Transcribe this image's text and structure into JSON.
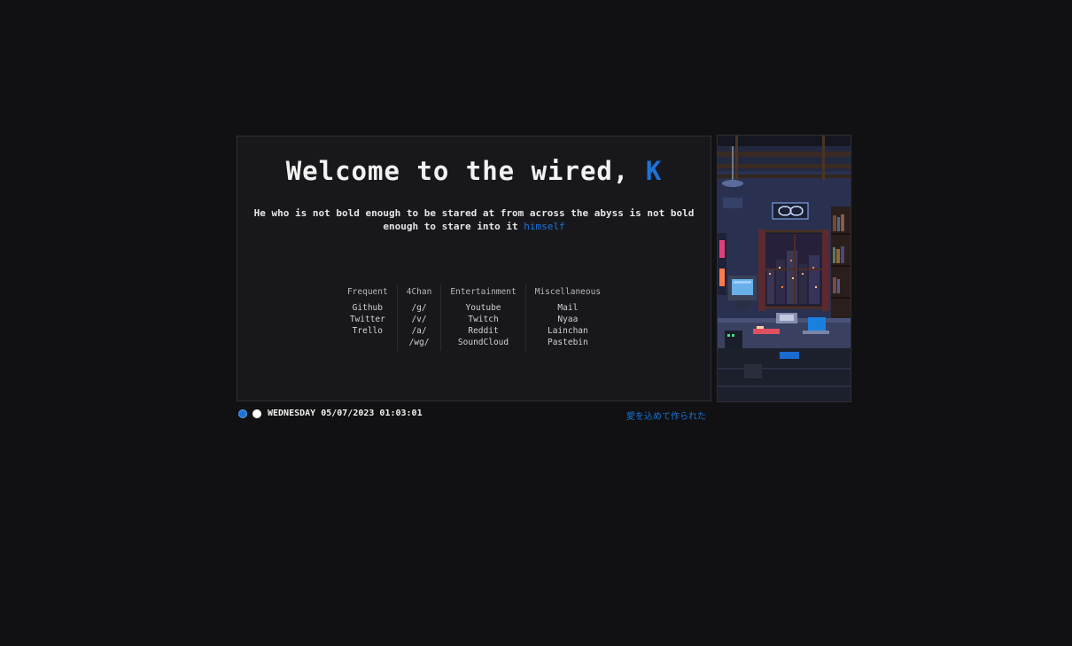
{
  "welcome": {
    "prefix": "Welcome to the wired, ",
    "name": "K"
  },
  "quote": {
    "text": "He who is not bold enough to be stared at from across the abyss is not bold enough to stare into it ",
    "accent": "himself"
  },
  "link_columns": [
    {
      "heading": "Frequent",
      "items": [
        "Github",
        "Twitter",
        "Trello"
      ]
    },
    {
      "heading": "4Chan",
      "items": [
        "/g/",
        "/v/",
        "/a/",
        "/wg/"
      ]
    },
    {
      "heading": "Entertainment",
      "items": [
        "Youtube",
        "Twitch",
        "Reddit",
        "SoundCloud"
      ]
    },
    {
      "heading": "Miscellaneous",
      "items": [
        "Mail",
        "Nyaa",
        "Lainchan",
        "Pastebin"
      ]
    }
  ],
  "status": {
    "datetime": "WEDNESDAY 05/07/2023 01:03:01",
    "credit": "愛を込めて作られた"
  },
  "colors": {
    "accent": "#1a74d8",
    "background": "#111113",
    "panel": "#18181c"
  },
  "icons": [
    "theme-dot-blue-icon",
    "theme-dot-white-icon",
    "pixel-art-room-image"
  ]
}
